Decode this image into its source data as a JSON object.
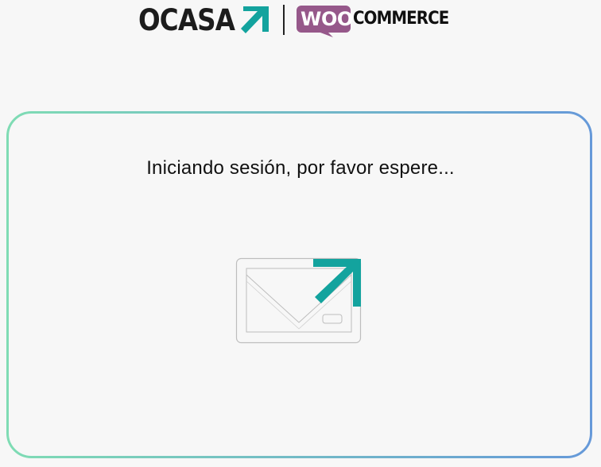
{
  "header": {
    "ocasa_logo_text": "OCASA",
    "woo_logo_text": "WOO",
    "commerce_logo_text": "COMMERCE"
  },
  "main": {
    "status_message": "Iniciando sesión, por favor espere..."
  },
  "icons": {
    "ocasa_arrow": "arrow-up-right-icon",
    "mail_graphic": "mail-send-icon"
  },
  "colors": {
    "background": "#f7f7f7",
    "teal_accent": "#13a39e",
    "woo_purple": "#96588a",
    "frame_gradient_start": "#7fdcb4",
    "frame_gradient_end": "#6699d9"
  }
}
